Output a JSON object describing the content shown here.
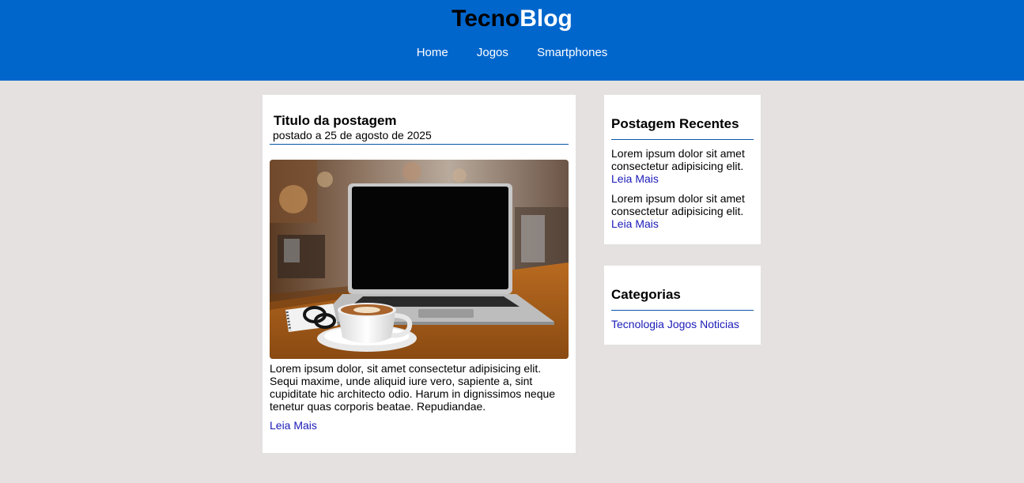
{
  "header": {
    "logo_part1": "Tecno",
    "logo_part2": "Blog",
    "colors": {
      "background": "#0066cc",
      "logo_part1": "#000000",
      "logo_part2": "#ffffff"
    },
    "nav": [
      {
        "label": "Home"
      },
      {
        "label": "Jogos"
      },
      {
        "label": "Smartphones"
      }
    ]
  },
  "post": {
    "title": "Titulo da postagem",
    "date": "postado a 25 de agosto de 2025",
    "image_subject": "laptop-and-coffee-photo",
    "body": "Lorem ipsum dolor, sit amet consectetur adipisicing elit. Sequi maxime, unde aliquid iure vero, sapiente a, sint cupiditate hic architecto odio. Harum in dignissimos neque tenetur quas corporis beatae. Repudiandae.",
    "read_more": "Leia Mais"
  },
  "sidebar": {
    "recent": {
      "title": "Postagem Recentes",
      "items": [
        {
          "text": "Lorem ipsum dolor sit amet consectetur adipisicing elit.",
          "link": "Leia Mais"
        },
        {
          "text": "Lorem ipsum dolor sit amet consectetur adipisicing elit.",
          "link": "Leia Mais"
        }
      ]
    },
    "categories": {
      "title": "Categorias",
      "items": [
        {
          "label": "Tecnologia"
        },
        {
          "label": "Jogos"
        },
        {
          "label": "Noticias"
        }
      ]
    }
  },
  "colors": {
    "page_background": "#e4e1e0",
    "accent_rule": "#0a55a5",
    "link": "#1a1ab8"
  }
}
